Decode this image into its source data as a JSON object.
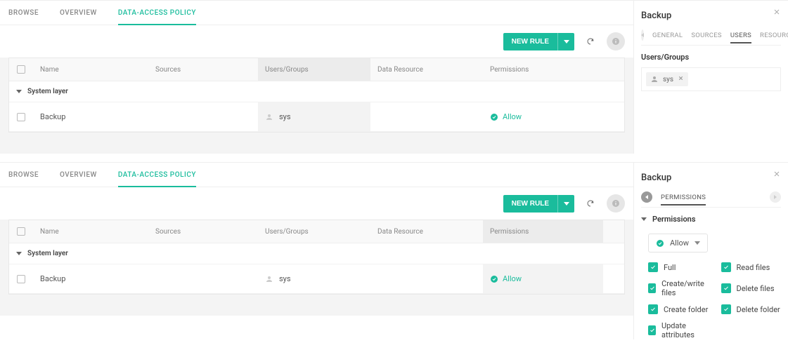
{
  "tabs": {
    "browse": "BROWSE",
    "overview": "OVERVIEW",
    "dap": "DATA-ACCESS POLICY"
  },
  "toolbar": {
    "newRule": "NEW RULE"
  },
  "columns": {
    "name": "Name",
    "sources": "Sources",
    "usersGroups": "Users/Groups",
    "dataResource": "Data Resource",
    "permissions": "Permissions"
  },
  "group": {
    "label": "System layer"
  },
  "row": {
    "name": "Backup",
    "user": "sys",
    "perm": "Allow"
  },
  "side1": {
    "title": "Backup",
    "tabs": {
      "general": "GENERAL",
      "sources": "SOURCES",
      "users": "USERS",
      "resources": "RESOURCES"
    },
    "usersLabel": "Users/Groups",
    "tag": "sys"
  },
  "side2": {
    "title": "Backup",
    "tab": "PERMISSIONS",
    "sectionLabel": "Permissions",
    "selectLabel": "Allow",
    "perms": {
      "full": "Full",
      "readFiles": "Read files",
      "createWrite": "Create/write files",
      "deleteFiles": "Delete files",
      "createFolder": "Create folder",
      "deleteFolder": "Delete folder",
      "updateAttrs": "Update attributes"
    }
  }
}
